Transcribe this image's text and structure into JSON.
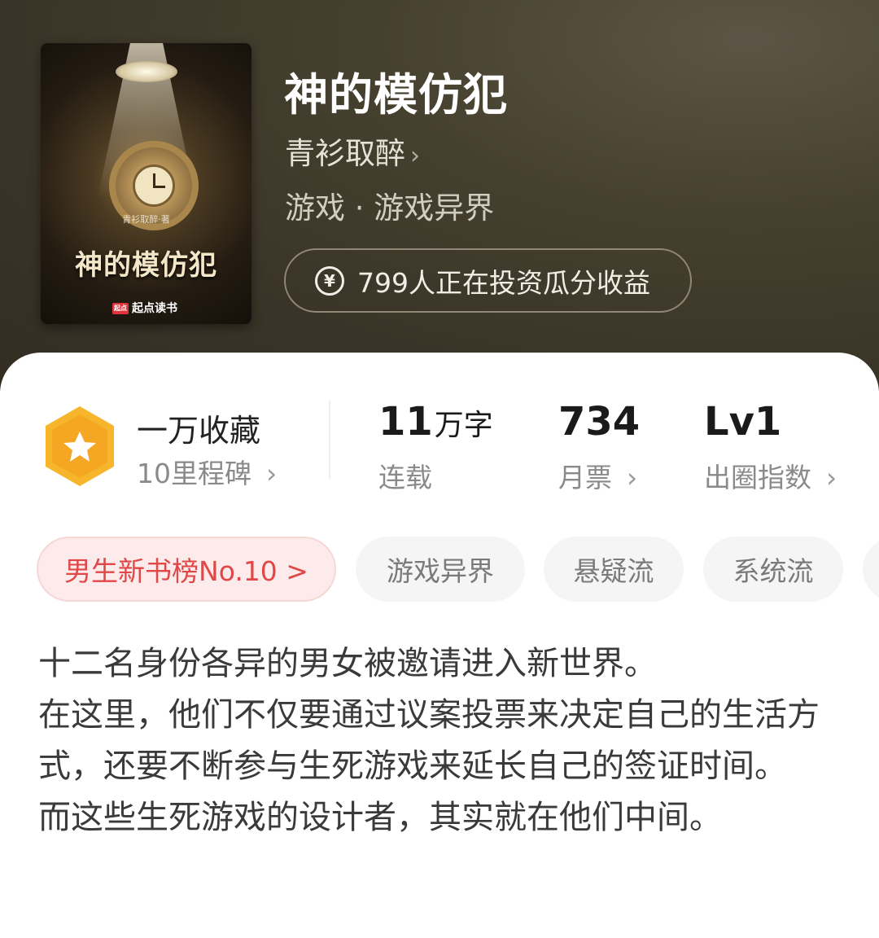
{
  "book": {
    "title": "神的模仿犯",
    "author": "青衫取醉",
    "author_chevron": "›",
    "category": "游戏 · 游戏异界",
    "invest_icon": "¥",
    "invest_text": "799人正在投资瓜分收益"
  },
  "cover": {
    "author_small": "青衫取醉·著",
    "title": "神的模仿犯",
    "publisher_logo": "起点",
    "publisher": "起点读书"
  },
  "stats": {
    "collect": {
      "title": "一万收藏",
      "subtitle": "10里程碑",
      "chevron": "›"
    },
    "words": {
      "value": "11",
      "unit": "万字",
      "label": "连载"
    },
    "tickets": {
      "value": "734",
      "label": "月票",
      "chevron": "›"
    },
    "index": {
      "value": "Lv1",
      "label": "出圈指数",
      "chevron": "›"
    }
  },
  "tags": [
    {
      "label": "男生新书榜No.10 >"
    },
    {
      "label": "游戏异界"
    },
    {
      "label": "悬疑流"
    },
    {
      "label": "系统流"
    }
  ],
  "description": [
    "十二名身份各异的男女被邀请进入新世界。",
    "在这里，他们不仅要通过议案投票来决定自己的生活方式，还要不断参与生死游戏来延长自己的签证时间。",
    "而这些生死游戏的设计者，其实就在他们中间。"
  ],
  "colors": {
    "header_bg": "#3f392c",
    "rank_tag_bg": "#fdeaea",
    "rank_tag_text": "#e04848",
    "badge": "#f7b52c"
  },
  "icons": {
    "badge": "star-hexagon-icon",
    "invest": "yen-circle-icon",
    "chevron": "chevron-right-icon"
  }
}
